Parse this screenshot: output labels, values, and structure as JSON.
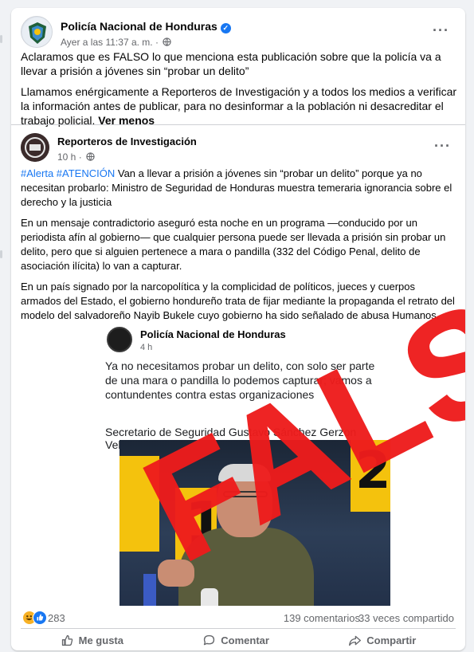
{
  "post": {
    "page_name": "Policía Nacional de Honduras",
    "timestamp": "Ayer a las 11:37 a. m.",
    "paragraph1": "Aclaramos que es FALSO lo que menciona esta publicación sobre que la policía va a llevar a prisión a jóvenes sin “probar un delito”",
    "paragraph2": "Llamamos enérgicamente a Reporteros de Investigación y a todos los medios a verificar la información antes de publicar, para no desinformar a la población ni desacreditar el trabajo policial.",
    "see_less": "Ver menos"
  },
  "shared_post": {
    "page_name": "Reporteros de Investigación",
    "timestamp": "10 h",
    "hashtags": "#Alerta #ATENCIÓN",
    "paragraph1_rest": " Van a llevar a prisión a jóvenes sin “probar un delito” porque ya no necesitan probarlo: Ministro de Seguridad de Honduras muestra temeraria ignorancia sobre el derecho y la justicia",
    "paragraph2": "En un mensaje contradictorio aseguró esta noche en un programa —conducido por un periodista afín al gobierno— que cualquier persona puede ser llevada a prisión sin probar un delito, pero que si alguien pertenece a mara o pandilla (332 del Código Penal, delito de asociación ilícita) lo van a capturar.",
    "paragraph3": "En un país signado por la narcopolítica y la complicidad de políticos, jueces y cuerpos armados del Estado, el gobierno hondureño trata de fijar mediante la propaganda el retrato del modelo del salvadoreño Nayib Bukele cuyo gobierno ha sido señalado de abusa Humanos."
  },
  "embedded_post": {
    "page_name": "Policía Nacional de Honduras",
    "timestamp": "4 h",
    "text": "Ya no necesitamos probar un delito, con solo ser parte de una mara o pandilla lo podemos capturar; vamos a contundentes contra estas organizaciones",
    "signature": "Secretario de Seguridad Gustavo Sánchez Gerzon Velásquez"
  },
  "stamp_text": "FALSO",
  "stats": {
    "reactions": "283",
    "comments": "139 comentarios",
    "shares": "33 veces compartido"
  },
  "actions": {
    "like": "Me gusta",
    "comment": "Comentar",
    "share": "Compartir"
  },
  "colors": {
    "brand": "#1877f2",
    "stamp": "#ee1c1c"
  }
}
